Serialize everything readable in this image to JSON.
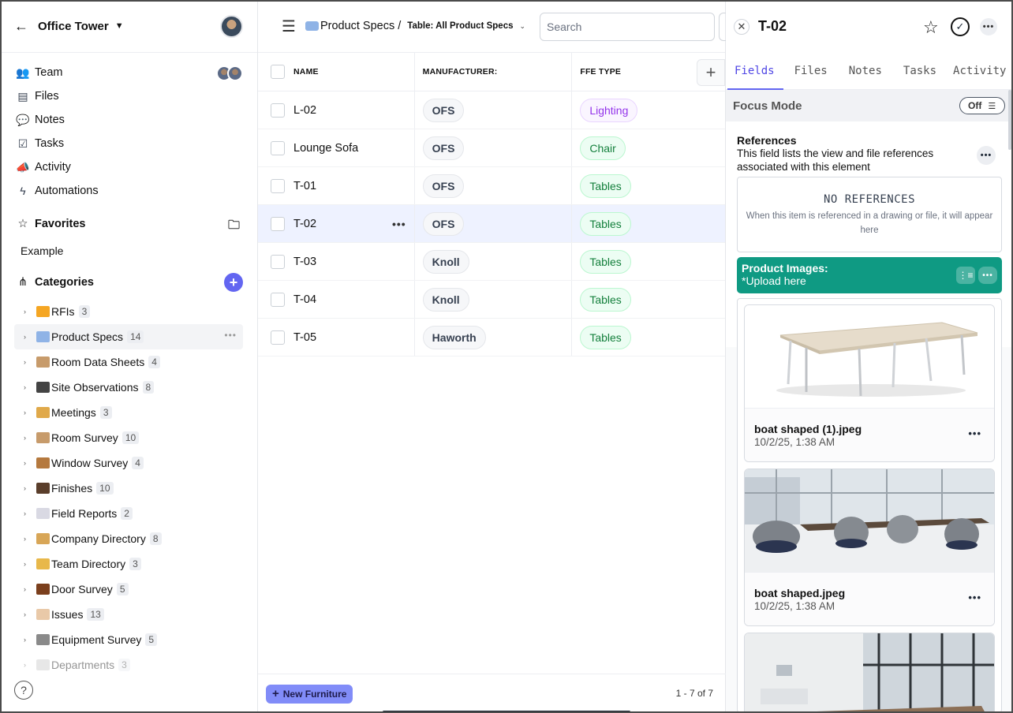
{
  "sidebar": {
    "project": "Office Tower",
    "nav": [
      {
        "label": "Team",
        "icon": "team-icon"
      },
      {
        "label": "Files",
        "icon": "files-icon"
      },
      {
        "label": "Notes",
        "icon": "notes-icon"
      },
      {
        "label": "Tasks",
        "icon": "tasks-icon"
      },
      {
        "label": "Activity",
        "icon": "activity-icon"
      },
      {
        "label": "Automations",
        "icon": "automations-icon"
      }
    ],
    "favorites_label": "Favorites",
    "favorites": [
      "Example"
    ],
    "categories_label": "Categories",
    "categories": [
      {
        "label": "RFIs",
        "count": "3",
        "emoji_color": "#f5a623"
      },
      {
        "label": "Product Specs",
        "count": "14",
        "emoji_color": "#8fb3e6"
      },
      {
        "label": "Room Data Sheets",
        "count": "4",
        "emoji_color": "#c79b6b"
      },
      {
        "label": "Site Observations",
        "count": "8",
        "emoji_color": "#444444"
      },
      {
        "label": "Meetings",
        "count": "3",
        "emoji_color": "#e0a94a"
      },
      {
        "label": "Room Survey",
        "count": "10",
        "emoji_color": "#c79b6b"
      },
      {
        "label": "Window Survey",
        "count": "4",
        "emoji_color": "#b5793e"
      },
      {
        "label": "Finishes",
        "count": "10",
        "emoji_color": "#5a3e2b"
      },
      {
        "label": "Field Reports",
        "count": "2",
        "emoji_color": "#d9d9e3"
      },
      {
        "label": "Company Directory",
        "count": "8",
        "emoji_color": "#d8a657"
      },
      {
        "label": "Team Directory",
        "count": "3",
        "emoji_color": "#e8b84a"
      },
      {
        "label": "Door Survey",
        "count": "5",
        "emoji_color": "#7b3f1d"
      },
      {
        "label": "Issues",
        "count": "13",
        "emoji_color": "#e9c9a8"
      },
      {
        "label": "Equipment Survey",
        "count": "5",
        "emoji_color": "#8a8a8a"
      },
      {
        "label": "Departments",
        "count": "3",
        "emoji_color": "#cccccc"
      }
    ],
    "help": "?"
  },
  "main": {
    "breadcrumb": "Product Specs /",
    "table_view": "Table: All Product Specs",
    "search_placeholder": "Search",
    "columns": [
      "NAME",
      "MANUFACTURER:",
      "FFE TYPE"
    ],
    "rows": [
      {
        "name": "L-02",
        "manufacturer": "OFS",
        "type": "Lighting",
        "type_style": "purple"
      },
      {
        "name": "Lounge Sofa",
        "manufacturer": "OFS",
        "type": "Chair",
        "type_style": "green"
      },
      {
        "name": "T-01",
        "manufacturer": "OFS",
        "type": "Tables",
        "type_style": "green"
      },
      {
        "name": "T-02",
        "manufacturer": "OFS",
        "type": "Tables",
        "type_style": "green",
        "selected": true
      },
      {
        "name": "T-03",
        "manufacturer": "Knoll",
        "type": "Tables",
        "type_style": "green"
      },
      {
        "name": "T-04",
        "manufacturer": "Knoll",
        "type": "Tables",
        "type_style": "green"
      },
      {
        "name": "T-05",
        "manufacturer": "Haworth",
        "type": "Tables",
        "type_style": "green"
      }
    ],
    "new_button": "New Furniture",
    "pager": "1 - 7 of 7"
  },
  "detail": {
    "title": "T-02",
    "tabs": [
      "Fields",
      "Files",
      "Notes",
      "Tasks",
      "Activity"
    ],
    "active_tab": "Fields",
    "focus_mode": "Focus Mode",
    "focus_state": "Off",
    "refs_title": "References",
    "refs_desc": "This field lists the view and file references associated with this element",
    "no_refs": "NO REFERENCES",
    "no_refs_hint": "When this item is referenced in a drawing or file, it will appear here",
    "product_images_title": "Product Images:",
    "product_images_sub": "*Upload here",
    "images": [
      {
        "name": "boat shaped (1).jpeg",
        "date": "10/2/25, 1:38 AM"
      },
      {
        "name": "boat shaped.jpeg",
        "date": "10/2/25, 1:38 AM"
      }
    ]
  },
  "colors": {
    "accent": "#6366f1",
    "teal": "#0f9a83",
    "selected_row": "#eef2ff"
  }
}
